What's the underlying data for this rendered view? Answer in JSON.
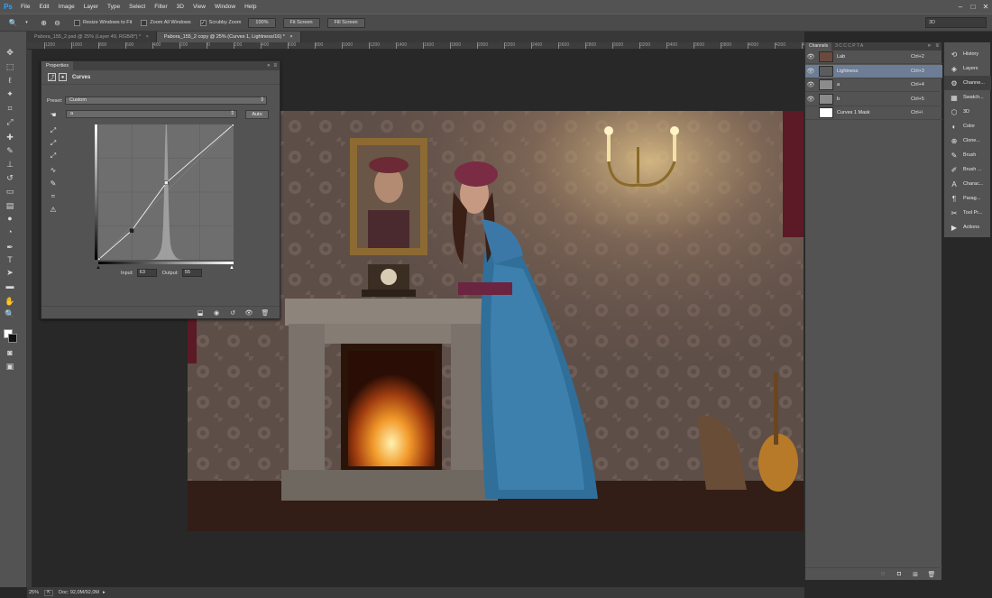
{
  "app": {
    "logo": "Ps"
  },
  "menu": [
    "File",
    "Edit",
    "Image",
    "Layer",
    "Type",
    "Select",
    "Filter",
    "3D",
    "View",
    "Window",
    "Help"
  ],
  "window_controls": [
    "–",
    "□",
    "✕"
  ],
  "options_bar": {
    "resize_windows_label": "Resize Windows to Fit",
    "zoom_all_label": "Zoom All Windows",
    "scrubby_zoom_label": "Scrubby Zoom",
    "btn_100": "100%",
    "btn_fit": "Fit Screen",
    "btn_fill": "Fill Screen",
    "workspace": "3D"
  },
  "tabs": [
    {
      "label": "Pabora_155_2.psd @ 25% (Layer 49, RGB/8*) *",
      "close": "×"
    },
    {
      "label": "Pabora_155_2 copy @ 25% (Curves 1, Lightness/16) *",
      "close": "×"
    }
  ],
  "ruler_labels": [
    "1200",
    "1000",
    "800",
    "600",
    "400",
    "200",
    "0",
    "200",
    "400",
    "600",
    "800",
    "1000",
    "1200",
    "1400",
    "1600",
    "1800",
    "2000",
    "2200",
    "2400",
    "2600",
    "2800",
    "3000",
    "3200",
    "3400",
    "3600",
    "3800",
    "4000",
    "4200",
    "4400"
  ],
  "properties": {
    "tab": "Properties",
    "title": "Curves",
    "preset_label": "Preset:",
    "preset_value": "Custom",
    "channel_value": "a",
    "auto_label": "Auto",
    "input_label": "Input:",
    "input_value": "63",
    "output_label": "Output:",
    "output_value": "55"
  },
  "curve": {
    "points_in": [
      0,
      63,
      128,
      255
    ],
    "points_out": [
      0,
      55,
      145,
      255
    ],
    "histogram_peak_at": 128
  },
  "channels": {
    "tab_active": "Channels",
    "other_tabs": "3 C C C P T A",
    "rows": [
      {
        "name": "Lab",
        "shortcut": "Ctrl+2",
        "visible": true,
        "selected": false,
        "thumb_color": "#6a4a3e"
      },
      {
        "name": "Lightness",
        "shortcut": "Ctrl+3",
        "visible": true,
        "selected": true,
        "thumb_color": "#5c5c5c"
      },
      {
        "name": "a",
        "shortcut": "Ctrl+4",
        "visible": true,
        "selected": false,
        "thumb_color": "#8c8c8c"
      },
      {
        "name": "b",
        "shortcut": "Ctrl+5",
        "visible": true,
        "selected": false,
        "thumb_color": "#8a8a8a"
      },
      {
        "name": "Curves 1 Mask",
        "shortcut": "Ctrl+\\",
        "visible": false,
        "selected": false,
        "thumb_color": "#ffffff"
      }
    ]
  },
  "dock": [
    {
      "label": "History",
      "icon": "⟲"
    },
    {
      "label": "Layers",
      "icon": "◈"
    },
    {
      "label": "Channe...",
      "icon": "⚙",
      "active": true
    },
    {
      "label": "Swatch...",
      "icon": "▦"
    },
    {
      "label": "3D",
      "icon": "⬡"
    },
    {
      "label": "Color",
      "icon": "◐"
    },
    {
      "label": "Clone...",
      "icon": "⊕"
    },
    {
      "label": "Brush",
      "icon": "✎"
    },
    {
      "label": "Brush ...",
      "icon": "✐"
    },
    {
      "label": "Charac...",
      "icon": "A"
    },
    {
      "label": "Parag...",
      "icon": "¶"
    },
    {
      "label": "Tool Pr...",
      "icon": "✂"
    },
    {
      "label": "Actions",
      "icon": "▶"
    }
  ],
  "status": {
    "zoom": "25%",
    "doc": "Doc: 92,0M/92,0M"
  }
}
